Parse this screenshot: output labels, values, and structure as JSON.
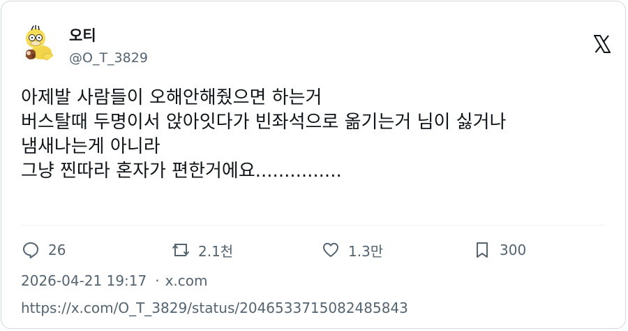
{
  "author": {
    "display_name": "오티",
    "handle": "@O_T_3829",
    "avatar_icon": "psyduck-avatar-icon"
  },
  "brand": {
    "logo_icon": "x-logo-icon"
  },
  "tweet": {
    "lines": [
      "아제발 사람들이 오해안해줬으면 하는거",
      "버스탈때 두명이서 앉아잇다가 빈좌석으로 옮기는거 님이 싫거나",
      "냄새나는게 아니라",
      "그냥 찐따라 혼자가 편한거에요..............."
    ]
  },
  "actions": {
    "reply": {
      "icon": "reply-icon",
      "count": "26"
    },
    "retweet": {
      "icon": "retweet-icon",
      "count": "2.1천"
    },
    "like": {
      "icon": "heart-icon",
      "count": "1.3만"
    },
    "bookmark": {
      "icon": "bookmark-icon",
      "count": "300"
    }
  },
  "meta": {
    "timestamp": "2026-04-21 19:17",
    "separator": "·",
    "source": "x.com"
  },
  "status_url": "https://x.com/O_T_3829/status/2046533715082485843",
  "colors": {
    "text_primary": "#0f1419",
    "text_secondary": "#536471",
    "border": "#cfd9de"
  }
}
